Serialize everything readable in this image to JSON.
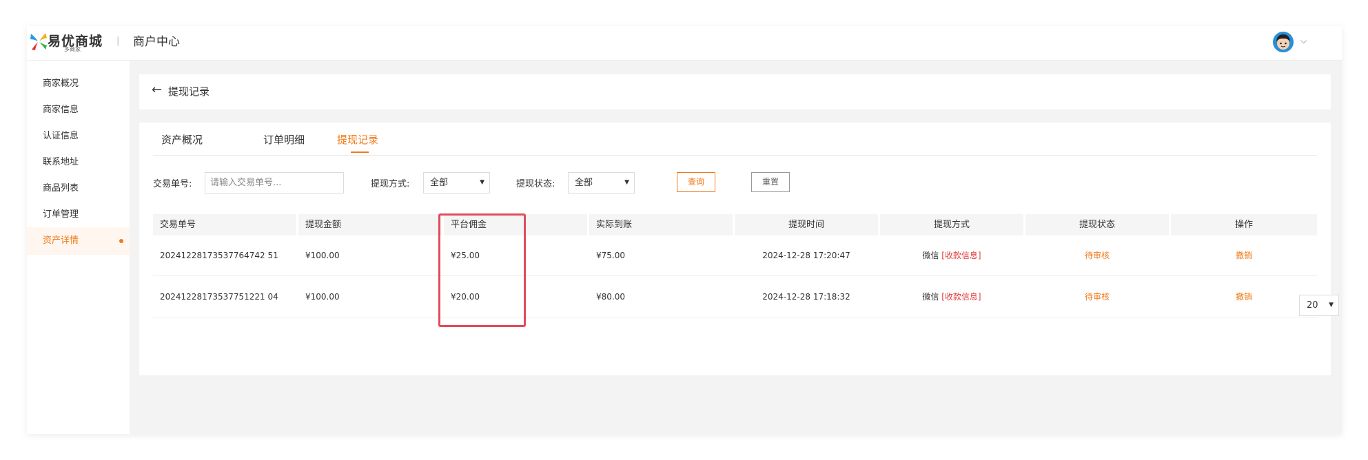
{
  "header": {
    "brand": "易优商城",
    "brand_sub": "多商家",
    "divider": "|",
    "title": "商户中心"
  },
  "sidebar": {
    "items": [
      {
        "label": "商家概况"
      },
      {
        "label": "商家信息"
      },
      {
        "label": "认证信息"
      },
      {
        "label": "联系地址"
      },
      {
        "label": "商品列表"
      },
      {
        "label": "订单管理"
      },
      {
        "label": "资产详情",
        "active": true
      }
    ]
  },
  "backbar": {
    "title": "提现记录"
  },
  "tabs": [
    {
      "label": "资产概况"
    },
    {
      "label": "订单明细"
    },
    {
      "label": "提现记录",
      "active": true
    }
  ],
  "filters": {
    "order_no_label": "交易单号:",
    "order_no_placeholder": "请输入交易单号...",
    "method_label": "提现方式:",
    "method_value": "全部",
    "status_label": "提现状态:",
    "status_value": "全部",
    "query_label": "查询",
    "reset_label": "重置"
  },
  "table": {
    "columns": [
      "交易单号",
      "提现金额",
      "平台佣金",
      "实际到账",
      "提现时间",
      "提现方式",
      "提现状态",
      "操作"
    ],
    "rows": [
      {
        "order_no": "20241228173537764742 51",
        "amount": "¥100.00",
        "commission": "¥25.00",
        "actual": "¥75.00",
        "time": "2024-12-28 17:20:47",
        "method": "微信",
        "method_link": "[收款信息]",
        "status": "待审核",
        "action": "撤销"
      },
      {
        "order_no": "20241228173537751221 04",
        "amount": "¥100.00",
        "commission": "¥20.00",
        "actual": "¥80.00",
        "time": "2024-12-28 17:18:32",
        "method": "微信",
        "method_link": "[收款信息]",
        "status": "待审核",
        "action": "撤销"
      }
    ]
  },
  "pager": {
    "page_size": "20"
  },
  "colors": {
    "accent": "#f07a1a",
    "red": "#e23b3b",
    "highlight": "#e24b5b"
  }
}
